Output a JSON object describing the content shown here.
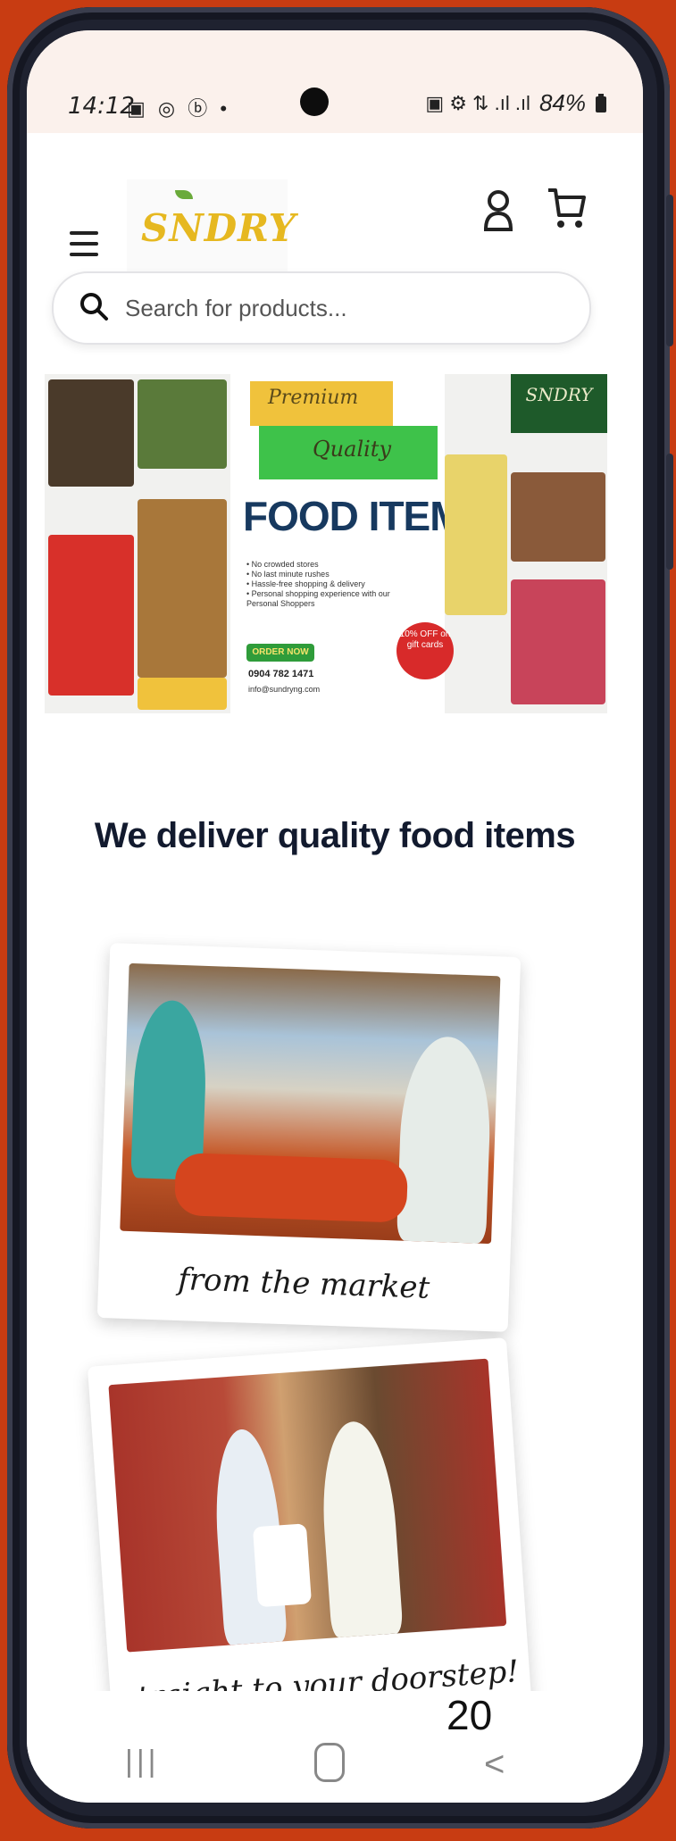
{
  "status_bar": {
    "time": "14:12",
    "left_icons": "▣ ◎ ⓑ •",
    "right_icons": "▣ ⚙ ⇅ .ıl .ıl",
    "battery": "84%"
  },
  "header": {
    "logo_text": "SNDRY",
    "menu_icon": "menu-icon",
    "account_icon": "user-icon",
    "cart_icon": "cart-icon"
  },
  "search": {
    "placeholder": "Search for products..."
  },
  "banner": {
    "premium": "Premium",
    "quality": "Quality",
    "title": "FOOD ITEMS",
    "bullets": [
      "• No crowded stores",
      "• No last minute rushes",
      "• Hassle-free shopping & delivery",
      "• Personal shopping experience with our Personal Shoppers"
    ],
    "order_button": "ORDER NOW",
    "phone": "0904 782 1471",
    "email": "info@sundryng.com",
    "discount": "10% OFF on gift cards",
    "mini_logo": "SNDRY"
  },
  "section": {
    "title": "We deliver quality food items"
  },
  "cards": [
    {
      "caption": "from the market"
    },
    {
      "caption": "straight to your doorstep!"
    }
  ],
  "navbar": {
    "recents": "|||",
    "back": "<"
  },
  "page_number": "20",
  "colors": {
    "background": "#c83c12",
    "brand_yellow": "#e6b820",
    "brand_green": "#3ec24a",
    "heading": "#121a2e"
  }
}
